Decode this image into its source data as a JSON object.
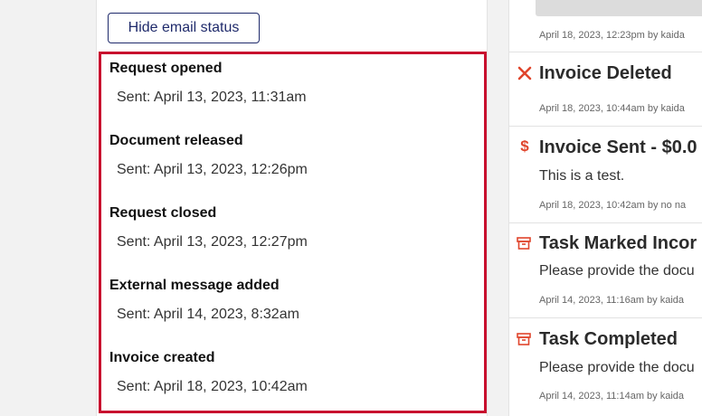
{
  "email_status": {
    "hide_button_label": "Hide email status",
    "items": [
      {
        "title": "Request opened",
        "sent": "Sent: April 13, 2023, 11:31am"
      },
      {
        "title": "Document released",
        "sent": "Sent: April 13, 2023, 12:26pm"
      },
      {
        "title": "Request closed",
        "sent": "Sent: April 13, 2023, 12:27pm"
      },
      {
        "title": "External message added",
        "sent": "Sent: April 14, 2023, 8:32am"
      },
      {
        "title": "Invoice created",
        "sent": "Sent: April 18, 2023, 10:42am"
      }
    ]
  },
  "activity": {
    "top_meta": "April 18, 2023, 12:23pm by kaida",
    "entries": [
      {
        "icon": "close-x-icon",
        "title": "Invoice Deleted",
        "body": "",
        "meta": "April 18, 2023, 10:44am by kaida"
      },
      {
        "icon": "dollar-icon",
        "title": "Invoice Sent - $0.0",
        "body": "This is a test.",
        "meta": "April 18, 2023, 10:42am by no na"
      },
      {
        "icon": "archive-box-icon",
        "title": "Task Marked Incor",
        "body": "Please provide the docu",
        "meta": "April 14, 2023, 11:16am by kaida"
      },
      {
        "icon": "archive-box-icon",
        "title": "Task Completed",
        "body": "Please provide the docu",
        "meta": "April 14, 2023, 11:14am by kaida"
      }
    ]
  },
  "colors": {
    "highlight_border": "#c8102e",
    "button_accent": "#1f2a6b",
    "icon_accent": "#e0452c"
  }
}
